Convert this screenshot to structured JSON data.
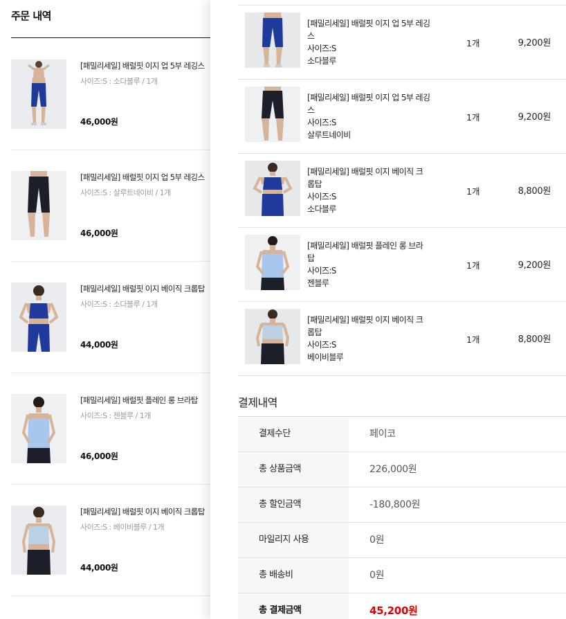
{
  "order_list": {
    "title": "주문 내역",
    "items": [
      {
        "name": "[패밀리세일] 배럴핏 이지 업 5부 레깅스",
        "option": "사이즈:S : 소다블루 / 1개",
        "price": "46,000원"
      },
      {
        "name": "[패밀리세일] 배럴핏 이지 업 5부 레깅스",
        "option": "사이즈:S : 살루트네이비 / 1개",
        "price": "46,000원"
      },
      {
        "name": "[패밀리세일] 배럴핏 이지 베이직 크롭탑",
        "option": "사이즈:S : 소다블루 / 1개",
        "price": "44,000원"
      },
      {
        "name": "[패밀리세일] 배럴핏 플레인 롱 브라탑",
        "option": "사이즈:S : 젠블루 / 1개",
        "price": "46,000원"
      },
      {
        "name": "[패밀리세일] 배럴핏 이지 베이직 크롭탑",
        "option": "사이즈:S : 베이비블루 / 1개",
        "price": "44,000원"
      }
    ]
  },
  "detail_products": [
    {
      "name_line1": "[패밀리세일] 배럴핏 이지 업 5부 레깅",
      "name_line2": "스",
      "size": "사이즈:S",
      "color": "소다블루",
      "qty": "1개",
      "price": "9,200원"
    },
    {
      "name_line1": "[패밀리세일] 배럴핏 이지 업 5부 레깅",
      "name_line2": "스",
      "size": "사이즈:S",
      "color": "살루트네이비",
      "qty": "1개",
      "price": "9,200원"
    },
    {
      "name_line1": "[패밀리세일] 배럴핏 이지 베이직 크",
      "name_line2": "롭탑",
      "size": "사이즈:S",
      "color": "소다블루",
      "qty": "1개",
      "price": "8,800원"
    },
    {
      "name_line1": "[패밀리세일] 배럴핏 플레인 롱 브라",
      "name_line2": "탑",
      "size": "사이즈:S",
      "color": "젠블루",
      "qty": "1개",
      "price": "9,200원"
    },
    {
      "name_line1": "[패밀리세일] 배럴핏 이지 베이직 크",
      "name_line2": "롭탑",
      "size": "사이즈:S",
      "color": "베이비블루",
      "qty": "1개",
      "price": "8,800원"
    }
  ],
  "payment": {
    "title": "결제내역",
    "rows": [
      {
        "label": "결제수단",
        "value": "페이코"
      },
      {
        "label": "총 상품금액",
        "value": "226,000원"
      },
      {
        "label": "총 할인금액",
        "value": "-180,800원"
      },
      {
        "label": "마일리지 사용",
        "value": "0원"
      },
      {
        "label": "총 배송비",
        "value": "0원"
      },
      {
        "label": "총 결제금액",
        "value": "45,200원"
      }
    ]
  },
  "colors": {
    "soda_blue": "#1f3a9a",
    "salute_navy": "#1c1f2a",
    "zen_blue": "#a9c6ec",
    "baby_blue": "#bcd0e4",
    "total_red": "#e00000"
  },
  "icons": [
    "product-photo-soda-blue-leggings",
    "product-photo-navy-leggings",
    "product-photo-soda-blue-croptop",
    "product-photo-zen-blue-bratop",
    "product-photo-baby-blue-croptop"
  ]
}
